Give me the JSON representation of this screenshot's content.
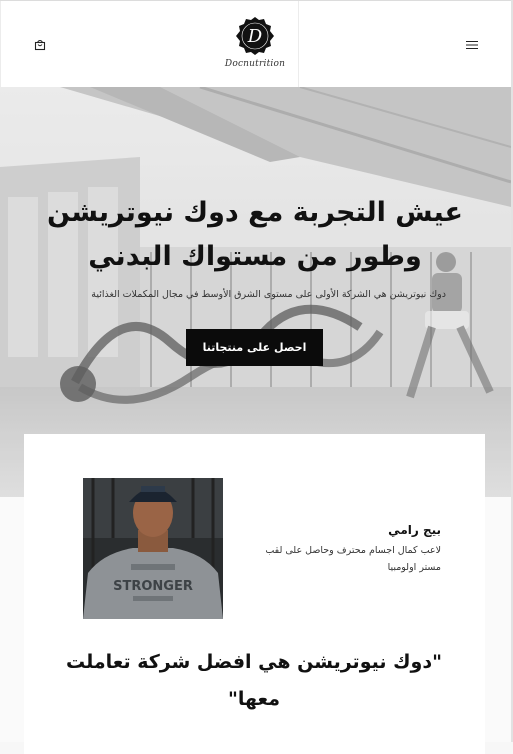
{
  "header": {
    "logo_text": "Docnutrition",
    "logo_letter": "D",
    "icons": {
      "cart": "shopping-bag-icon",
      "menu": "hamburger-menu-icon"
    }
  },
  "hero": {
    "title": "عيش التجربة مع دوك نيوتريشن وطور من مستواك البدني",
    "subtitle": "دوك نيوتريشن هي الشركة الأولى على مستوى الشرق الأوسط في مجال المكملات الغذائية",
    "cta_label": "احصل على منتجاتنا"
  },
  "testimonial": {
    "name": "بيج رامي",
    "role": "لاعب كمال اجسام محترف وحاصل على لقب مستر اولومبيا",
    "quote": "\"دوك نيوتريشن هي افضل شركة تعاملت معها\"",
    "photo_shirt_text": "STRONGER"
  },
  "colors": {
    "cta_bg": "#0b0b0b",
    "text": "#111111",
    "header_bg": "#ffffff"
  }
}
